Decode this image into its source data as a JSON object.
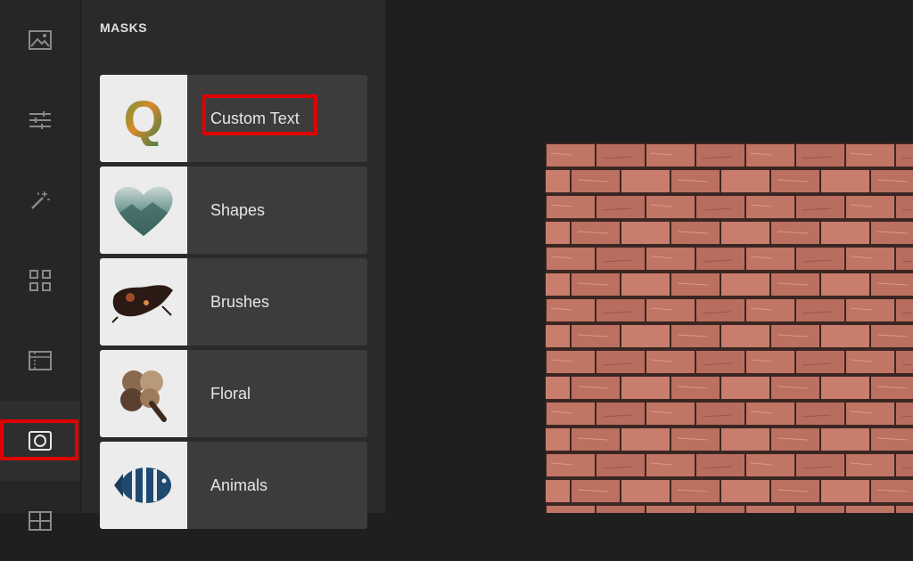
{
  "rail": {
    "items": [
      {
        "icon": "image-icon"
      },
      {
        "icon": "sliders-icon"
      },
      {
        "icon": "magic-wand-icon"
      },
      {
        "icon": "grid-icon"
      },
      {
        "icon": "texture-icon"
      },
      {
        "icon": "mask-icon",
        "active": true
      },
      {
        "icon": "layout-icon"
      }
    ]
  },
  "panel": {
    "title": "MASKS",
    "items": [
      {
        "label": "Custom Text",
        "thumb": "letter-q-thumbnail",
        "thumb_letter": "Q"
      },
      {
        "label": "Shapes",
        "thumb": "heart-thumbnail"
      },
      {
        "label": "Brushes",
        "thumb": "brush-stroke-thumbnail"
      },
      {
        "label": "Floral",
        "thumb": "clover-thumbnail"
      },
      {
        "label": "Animals",
        "thumb": "fish-thumbnail"
      }
    ]
  },
  "colors": {
    "highlight": "#e00000",
    "brick": "#c17565",
    "mortar": "#3a2622"
  }
}
